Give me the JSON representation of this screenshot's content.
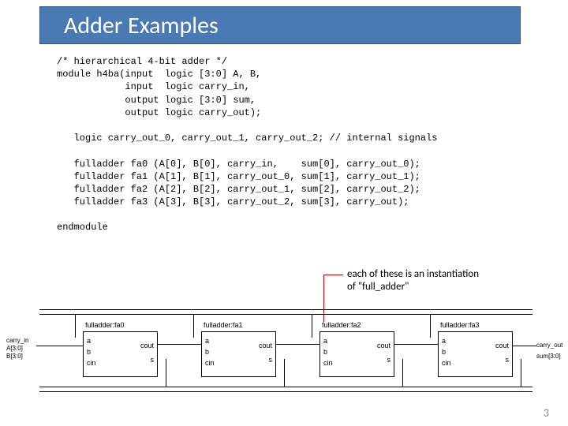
{
  "title": "Adder Examples",
  "code": "/* hierarchical 4-bit adder */\nmodule h4ba(input  logic [3:0] A, B,\n            input  logic carry_in,\n            output logic [3:0] sum,\n            output logic carry_out);\n\n   logic carry_out_0, carry_out_1, carry_out_2; // internal signals\n\n   fulladder fa0 (A[0], B[0], carry_in,    sum[0], carry_out_0);\n   fulladder fa1 (A[1], B[1], carry_out_0, sum[1], carry_out_1);\n   fulladder fa2 (A[2], B[2], carry_out_1, sum[2], carry_out_2);\n   fulladder fa3 (A[3], B[3], carry_out_2, sum[3], carry_out);\n\nendmodule",
  "annotation": {
    "line1": "each of these is an instantiation",
    "line2": "of \"full_adder\""
  },
  "diagram": {
    "blocks": [
      {
        "label": "fulladder:fa0"
      },
      {
        "label": "fulladder:fa1"
      },
      {
        "label": "fulladder:fa2"
      },
      {
        "label": "fulladder:fa3"
      }
    ],
    "ports_left": [
      "a",
      "b",
      "cin"
    ],
    "ports_right": [
      "cout",
      "s"
    ],
    "input_labels": [
      "carry_in",
      "A[3:0]",
      "B[3:0]"
    ],
    "output_labels": [
      "carry_out",
      "sum[3:0]"
    ]
  },
  "page_number": "3"
}
